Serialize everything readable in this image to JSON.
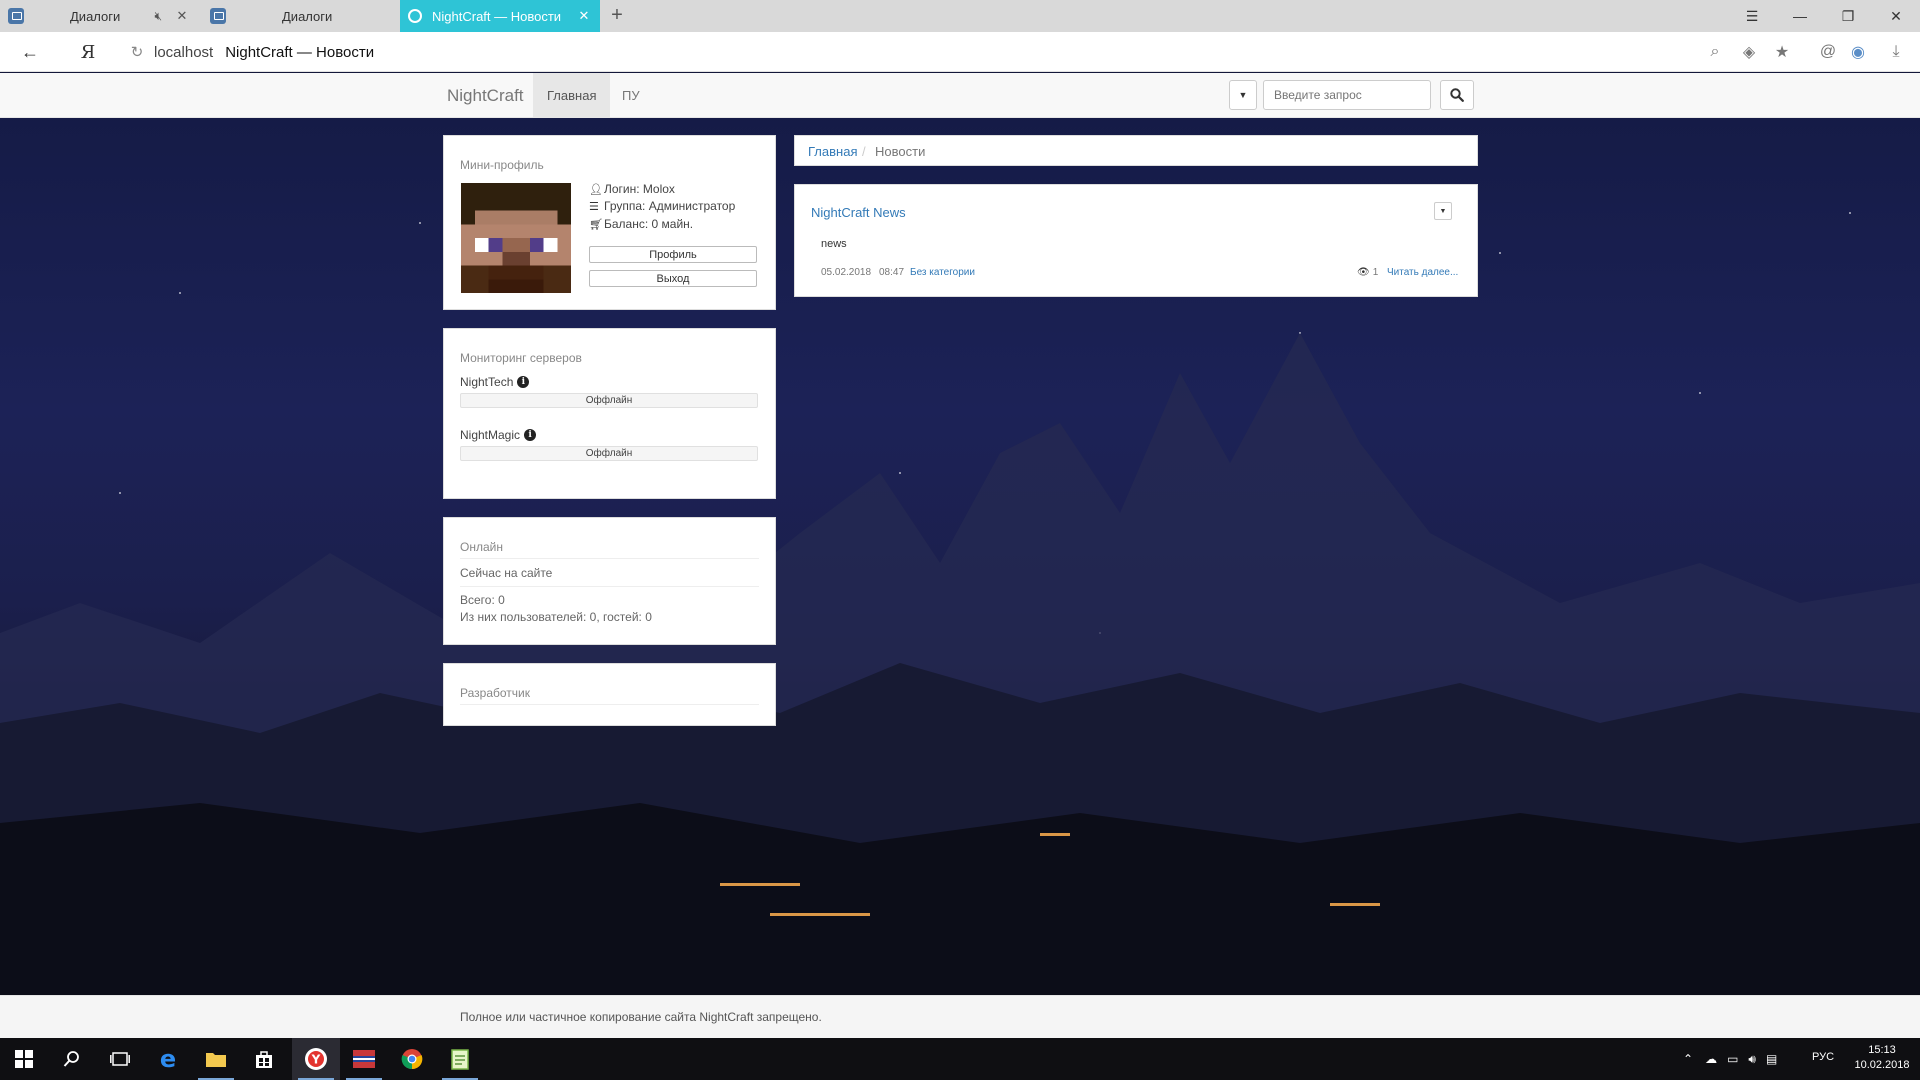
{
  "browser": {
    "tabs": [
      {
        "title": "Диалоги",
        "muted": true
      },
      {
        "title": "Диалоги"
      },
      {
        "title": "NightCraft — Новости",
        "active": true
      }
    ],
    "address": {
      "host": "localhost",
      "title": "NightCraft — Новости"
    }
  },
  "nav": {
    "brand": "NightCraft",
    "items": [
      "Главная",
      "ПУ"
    ],
    "search_placeholder": "Введите запрос"
  },
  "mini_profile": {
    "title": "Мини-профиль",
    "login": "Логин: Molox",
    "group": "Группа: Администратор",
    "balance": "Баланс: 0 майн.",
    "profile_button": "Профиль",
    "logout_button": "Выход"
  },
  "monitoring": {
    "title": "Мониторинг серверов",
    "servers": [
      {
        "name": "NightTech",
        "status": "Оффлайн"
      },
      {
        "name": "NightMagic",
        "status": "Оффлайн"
      }
    ]
  },
  "online": {
    "title": "Онлайн",
    "subtitle": "Сейчас на сайте",
    "total": "Всего: 0",
    "breakdown": "Из них пользователей: 0, гостей: 0"
  },
  "developer": {
    "title": "Разработчик"
  },
  "breadcrumb": {
    "home": "Главная",
    "sep": "/",
    "current": "Новости"
  },
  "news": {
    "title": "NightCraft News",
    "body": "news",
    "date": "05.02.2018",
    "time": "08:47",
    "category": "Без категории",
    "views": "1",
    "read_more": "Читать далее..."
  },
  "footer": {
    "text": "Полное или частичное копирование сайта NightCraft запрещено."
  },
  "taskbar": {
    "lang": "РУС",
    "time": "15:13",
    "date": "10.02.2018"
  },
  "colors": {
    "accent": "#337ab7",
    "active_tab": "#2ec4d6",
    "navbar": "#f8f8f8"
  }
}
